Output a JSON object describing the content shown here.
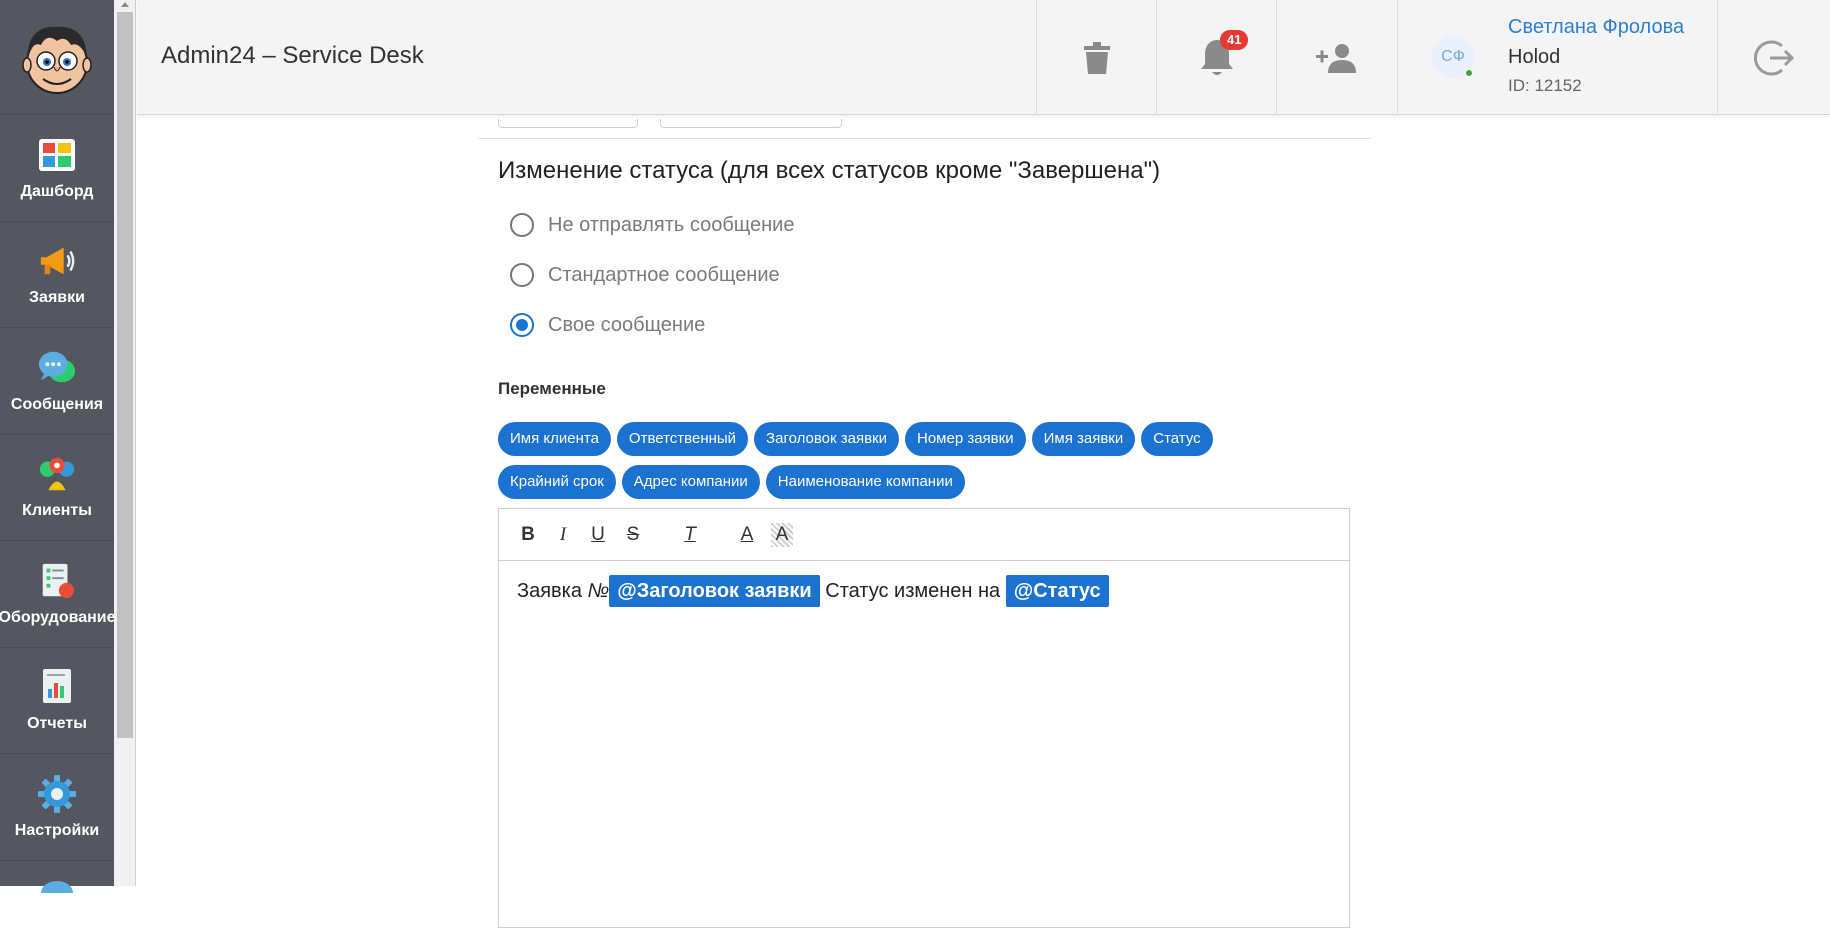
{
  "app": {
    "title": "Admin24 – Service Desk"
  },
  "sidebar": {
    "items": [
      {
        "label": "Дашборд",
        "icon": "dashboard-icon"
      },
      {
        "label": "Заявки",
        "icon": "megaphone-icon"
      },
      {
        "label": "Сообщения",
        "icon": "chat-bubbles-icon"
      },
      {
        "label": "Клиенты",
        "icon": "clients-icon"
      },
      {
        "label": "Оборудование",
        "icon": "equipment-icon"
      },
      {
        "label": "Отчеты",
        "icon": "reports-icon"
      },
      {
        "label": "Настройки",
        "icon": "settings-gear-icon"
      }
    ]
  },
  "header": {
    "notifications_count": "41",
    "user": {
      "initials": "СФ",
      "name": "Светлана Фролова",
      "company": "Holod",
      "id_text": "ID: 12152"
    }
  },
  "section": {
    "title": "Изменение статуса (для всех статусов кроме \"Завершена\")",
    "options": [
      {
        "label": "Не отправлять сообщение",
        "checked": false
      },
      {
        "label": "Стандартное сообщение",
        "checked": false
      },
      {
        "label": "Свое сообщение",
        "checked": true
      }
    ]
  },
  "variables": {
    "title": "Переменные",
    "chips": [
      "Имя клиента",
      "Ответственный",
      "Заголовок заявки",
      "Номер заявки",
      "Имя заявки",
      "Статус",
      "Крайний срок",
      "Адрес компании",
      "Наименование компании"
    ]
  },
  "editor": {
    "toolbar": {
      "bold": "B",
      "italic": "I",
      "underline": "U",
      "strike": "S",
      "clear": "T",
      "font_color": "A",
      "bg_color": "A"
    },
    "text_prefix": "Заявка ",
    "text_number_sign": "№",
    "var1": "@Заголовок заявки",
    "text_middle": " Статус изменен на ",
    "var2": "@Статус"
  },
  "colors": {
    "sidebar_bg": "#54575f",
    "accent": "#1b72d1",
    "badge": "#e53935",
    "header_bg": "#f4f4f4"
  }
}
